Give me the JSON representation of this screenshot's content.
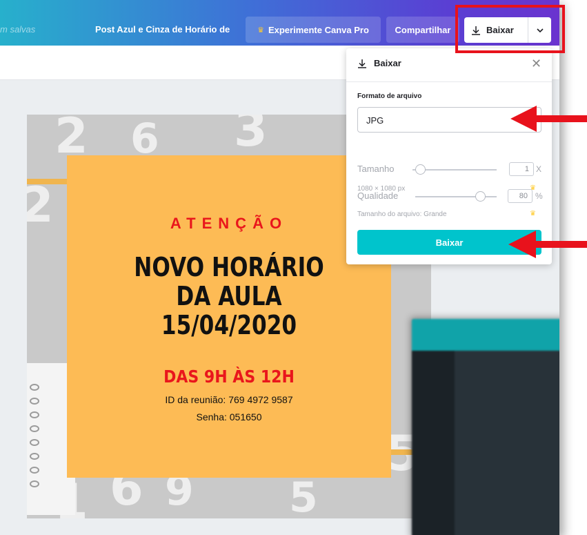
{
  "topbar": {
    "saved_text": "m salvas",
    "doc_title": "Post Azul e Cinza de Horário de",
    "pro_button": "Experimente Canva Pro",
    "share_button": "Compartilhar",
    "download_button": "Baixar"
  },
  "design": {
    "attention": "ATENÇÃO",
    "headline_1": "NOVO HORÁRIO",
    "headline_2": "DA AULA",
    "headline_3": "15/04/2020",
    "hours": "DAS 9H ÀS 12H",
    "meeting_id": "ID da reunião: 769 4972 9587",
    "password": "Senha: 051650"
  },
  "download_panel": {
    "title": "Baixar",
    "format_label": "Formato de arquivo",
    "format_value": "JPG",
    "size_label": "Tamanho",
    "size_value": "1",
    "size_unit": "X",
    "size_slider_fraction": 0.09,
    "dimensions_note": "1080 × 1080 px",
    "quality_label": "Qualidade",
    "quality_value": "80",
    "quality_unit": "%",
    "quality_slider_fraction": 0.8,
    "file_size_note": "Tamanho do arquivo: Grande",
    "submit_button": "Baixar"
  },
  "colors": {
    "card_orange": "#fdbb55",
    "attention_red": "#e9161c",
    "download_teal": "#00c4cc",
    "highlight_red": "#e8121c"
  }
}
